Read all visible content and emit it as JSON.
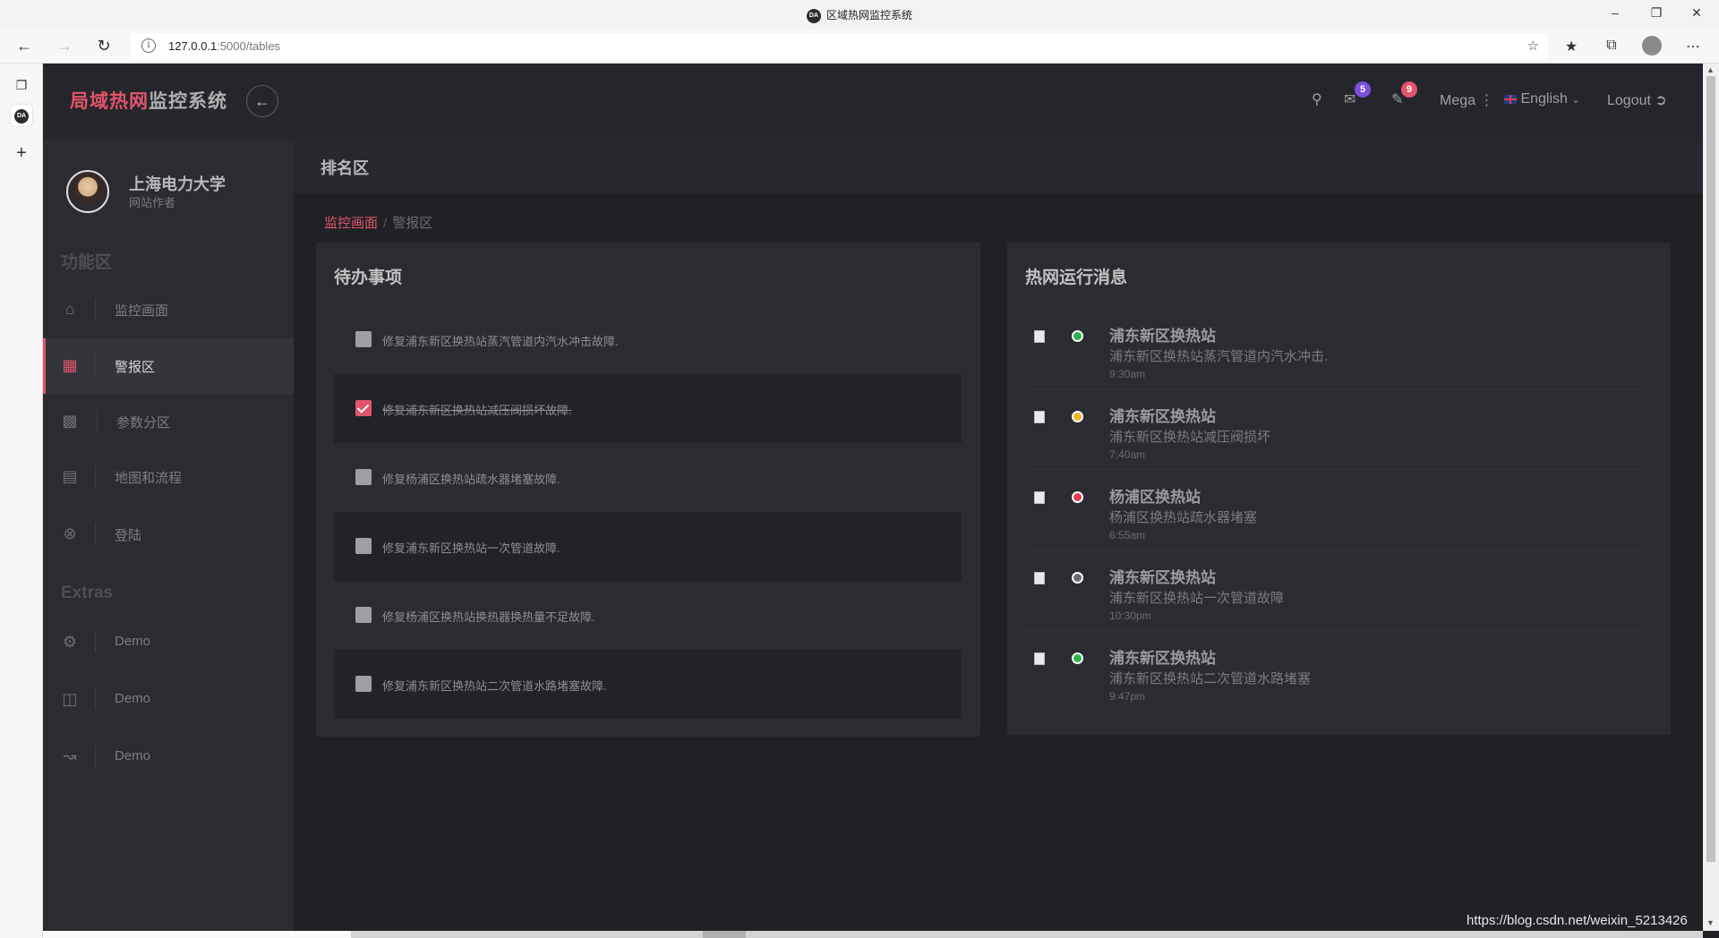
{
  "browser": {
    "window_title": "区域热网监控系统",
    "favicon_text": "DA",
    "url_host": "127.0.0.1",
    "url_path": ":5000/tables"
  },
  "app": {
    "brand_accent": "局域热网",
    "brand_rest": "监控系统",
    "mail_badge": "5",
    "notif_badge": "9",
    "mega_label": "Mega",
    "language_label": "English",
    "logout_label": "Logout",
    "colors": {
      "accent": "#e2546b",
      "badge_purple": "#7b4ee0",
      "badge_red": "#e2546b"
    }
  },
  "sidebar": {
    "profile_name": "上海电力大学",
    "profile_role": "网站作者",
    "section1": "功能区",
    "section2": "Extras",
    "items": [
      {
        "label": "监控画面",
        "icon": "home-icon"
      },
      {
        "label": "警报区",
        "icon": "grid-icon"
      },
      {
        "label": "参数分区",
        "icon": "bar-chart-icon"
      },
      {
        "label": "地图和流程",
        "icon": "clipboard-icon"
      },
      {
        "label": "登陆",
        "icon": "login-icon"
      }
    ],
    "extras": [
      {
        "label": "Demo",
        "icon": "gear-icon"
      },
      {
        "label": "Demo",
        "icon": "presentation-icon"
      },
      {
        "label": "Demo",
        "icon": "line-chart-icon"
      }
    ]
  },
  "page": {
    "title": "排名区",
    "breadcrumb_home": "监控画面",
    "breadcrumb_current": "警报区"
  },
  "todo": {
    "title": "待办事项",
    "items": [
      {
        "text": "修复浦东新区换热站蒸汽管道内汽水冲击故障.",
        "done": false
      },
      {
        "text": "修复浦东新区换热站减压阀损坏故障.",
        "done": true
      },
      {
        "text": "修复杨浦区换热站疏水器堵塞故障.",
        "done": false
      },
      {
        "text": "修复浦东新区换热站一次管道故障.",
        "done": false
      },
      {
        "text": "修复杨浦区换热站换热器换热量不足故障.",
        "done": false
      },
      {
        "text": "修复浦东新区换热站二次管道水路堵塞故障.",
        "done": false
      }
    ]
  },
  "messages": {
    "title": "热网运行消息",
    "items": [
      {
        "title": "浦东新区换热站",
        "body": "浦东新区换热站蒸汽管道内汽水冲击.",
        "time": "9:30am",
        "status_color": "#2fb14e"
      },
      {
        "title": "浦东新区换热站",
        "body": "浦东新区换热站减压阀损坏",
        "time": "7:40am",
        "status_color": "#f0b429"
      },
      {
        "title": "杨浦区换热站",
        "body": "杨浦区换热站疏水器堵塞",
        "time": "6:55am",
        "status_color": "#e23d4f"
      },
      {
        "title": "浦东新区换热站",
        "body": "浦东新区换热站一次管道故障",
        "time": "10:30pm",
        "status_color": "#6c6e74"
      },
      {
        "title": "浦东新区换热站",
        "body": "浦东新区换热站二次管道水路堵塞",
        "time": "9:47pm",
        "status_color": "#2fb14e"
      }
    ]
  },
  "watermark": "https://blog.csdn.net/weixin_5213426"
}
